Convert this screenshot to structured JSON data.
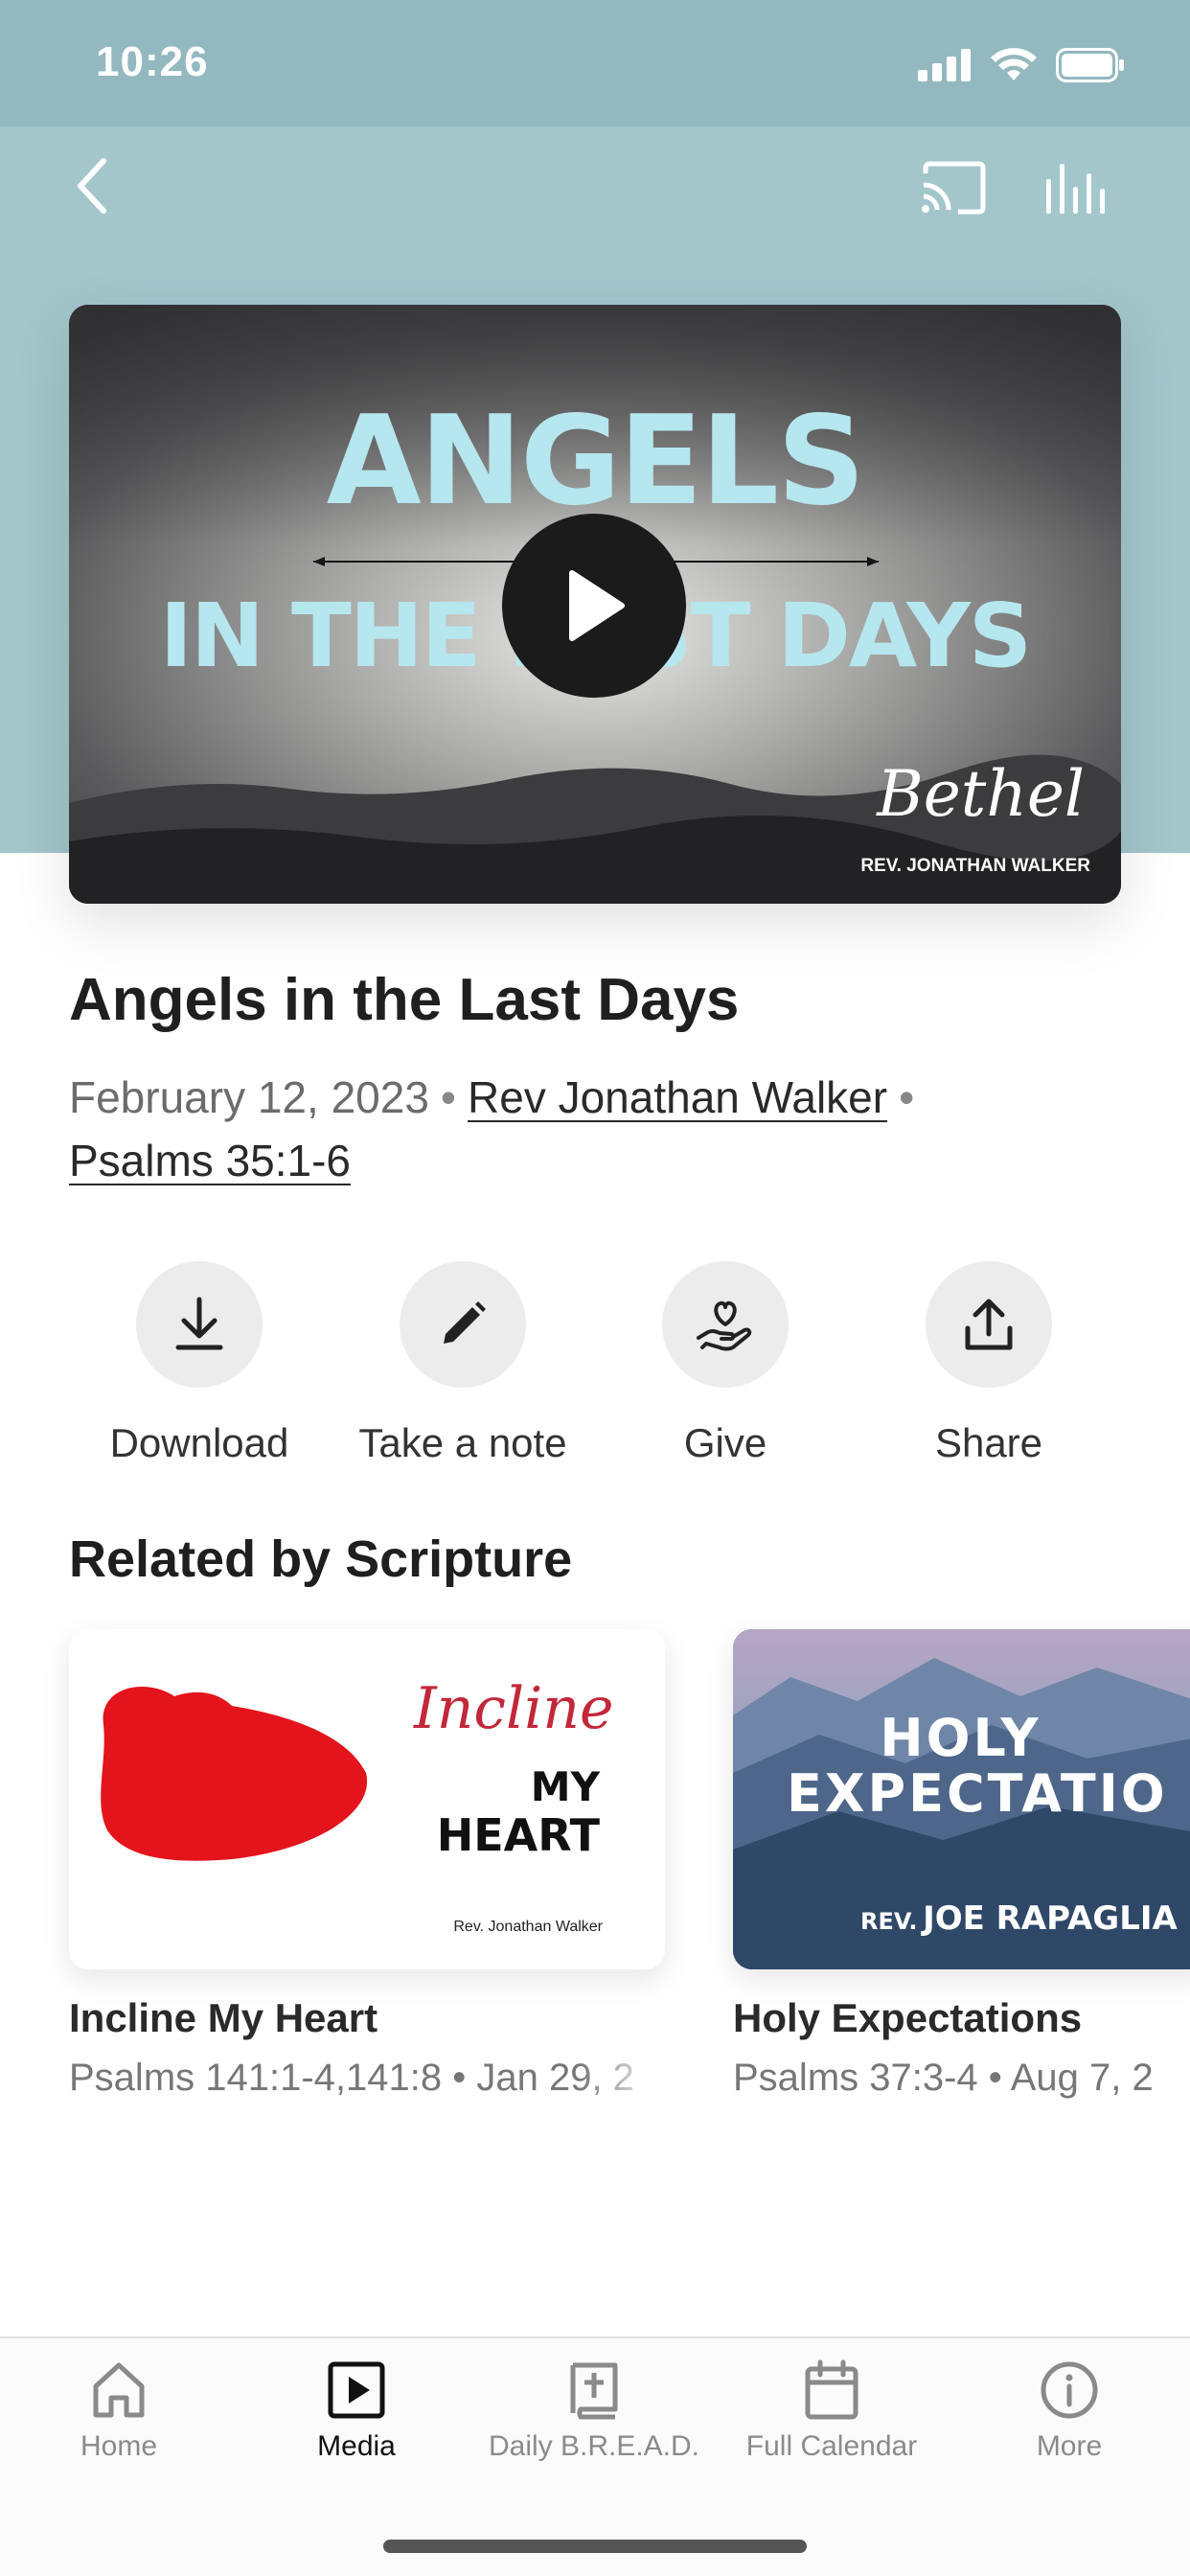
{
  "status_bar": {
    "time": "10:26"
  },
  "video": {
    "art_title_line1": "ANGELS",
    "art_title_line2": "IN THE LAST DAYS",
    "art_brand": "Bethel",
    "art_speaker": "REV. JONATHAN WALKER"
  },
  "sermon": {
    "title": "Angels in the Last Days",
    "date": "February 12, 2023",
    "speaker": "Rev Jonathan Walker",
    "scripture": "Psalms 35:1-6",
    "separator": "•"
  },
  "actions": [
    {
      "label": "Download",
      "icon": "download-icon"
    },
    {
      "label": "Take a note",
      "icon": "pencil-icon"
    },
    {
      "label": "Give",
      "icon": "give-heart-hand-icon"
    },
    {
      "label": "Share",
      "icon": "share-icon"
    }
  ],
  "related": {
    "title": "Related by Scripture",
    "items": [
      {
        "title": "Incline My Heart",
        "subtitle": "Psalms 141:1-4,141:8 • Jan 29, 2",
        "art_script": "Incline",
        "art_line2": "MY",
        "art_line3": "HEART",
        "art_speaker": "Rev. Jonathan Walker"
      },
      {
        "title": "Holy Expectations",
        "subtitle": "Psalms 37:3-4 • Aug 7, 2",
        "art_line1": "HOLY",
        "art_line2": "EXPECTATIO",
        "art_speaker_prefix": "REV.",
        "art_speaker": "JOE RAPAGLIA"
      }
    ]
  },
  "tabs": [
    {
      "label": "Home",
      "icon": "home-icon",
      "active": false
    },
    {
      "label": "Media",
      "icon": "media-play-icon",
      "active": true
    },
    {
      "label": "Daily B.R.E.A.D.",
      "icon": "bible-icon",
      "active": false
    },
    {
      "label": "Full Calendar",
      "icon": "calendar-icon",
      "active": false
    },
    {
      "label": "More",
      "icon": "info-icon",
      "active": false
    }
  ],
  "colors": {
    "header_bg": "#a3c6cb",
    "status_bg": "#93b8bf",
    "art_title": "#b6e6ee",
    "action_circle": "#ececec",
    "heart_red": "#e3141b",
    "script_pink": "#c2283a"
  }
}
